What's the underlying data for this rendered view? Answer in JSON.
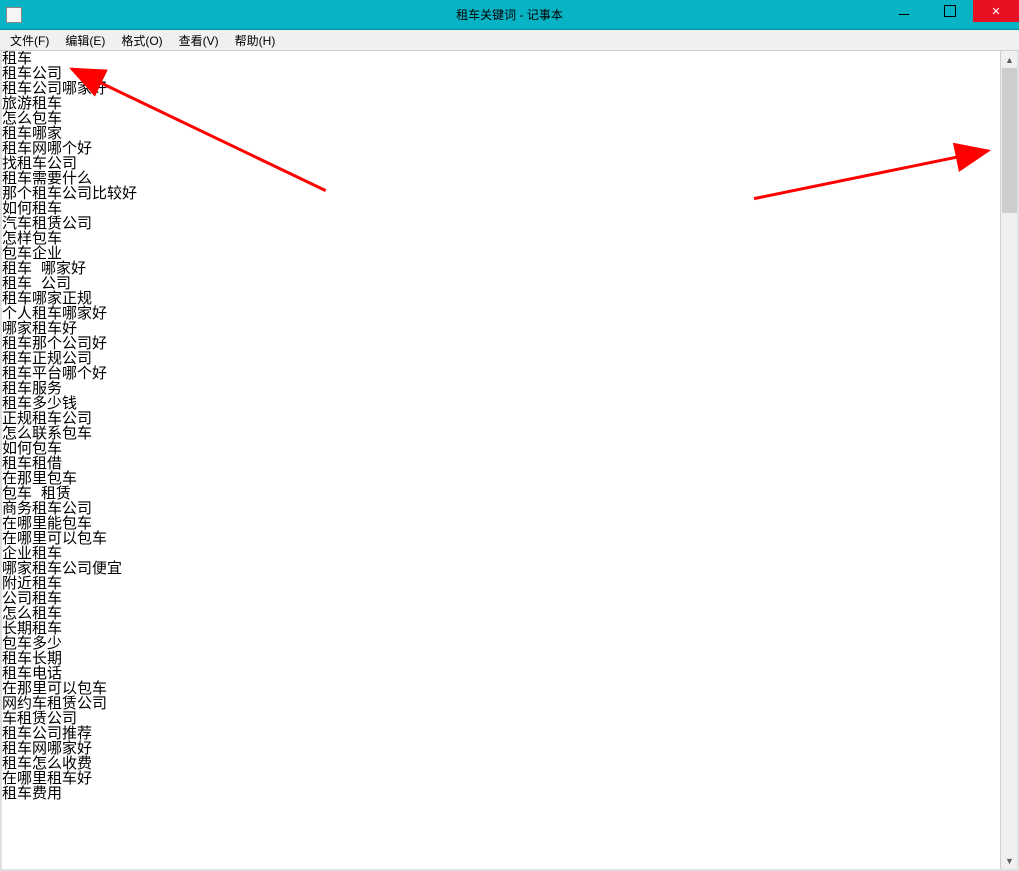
{
  "window": {
    "title": "租车关键词 - 记事本"
  },
  "menu": {
    "file": "文件(F)",
    "edit": "编辑(E)",
    "format": "格式(O)",
    "view": "查看(V)",
    "help": "帮助(H)"
  },
  "content": {
    "lines": [
      "租车",
      "租车公司",
      "租车公司哪家好",
      "旅游租车",
      "怎么包车",
      "租车哪家",
      "租车网哪个好",
      "找租车公司",
      "租车需要什么",
      "那个租车公司比较好",
      "如何租车",
      "汽车租赁公司",
      "怎样包车",
      "包车企业",
      "租车 哪家好",
      "租车 公司",
      "租车哪家正规",
      "个人租车哪家好",
      "哪家租车好",
      "租车那个公司好",
      "租车正规公司",
      "租车平台哪个好",
      "租车服务",
      "租车多少钱",
      "正规租车公司",
      "怎么联系包车",
      "如何包车",
      "租车租借",
      "在那里包车",
      "包车 租赁",
      "商务租车公司",
      "在哪里能包车",
      "在哪里可以包车",
      "企业租车",
      "哪家租车公司便宜",
      "附近租车",
      "公司租车",
      "怎么租车",
      "长期租车",
      "包车多少",
      "租车长期",
      "租车电话",
      "在那里可以包车",
      "网约车租赁公司",
      "车租赁公司",
      "租车公司推荐",
      "租车网哪家好",
      "租车怎么收费",
      "在哪里租车好",
      "租车费用"
    ]
  },
  "annotations": {
    "arrow_color": "#ff0000"
  }
}
